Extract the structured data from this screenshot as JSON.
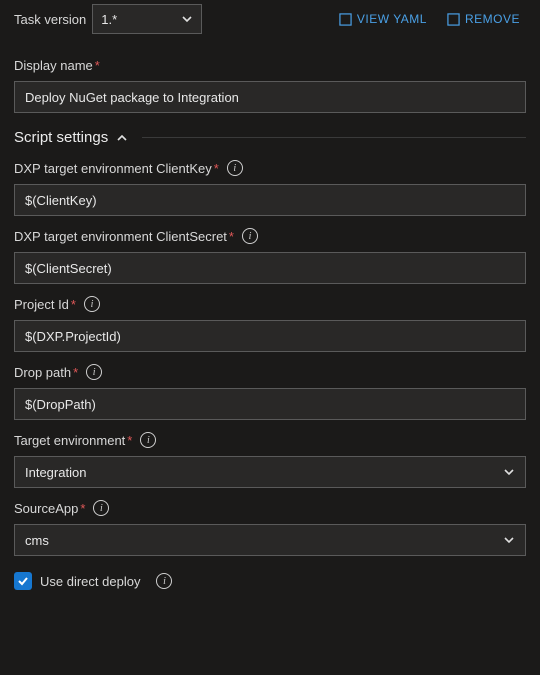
{
  "header": {
    "task_version_label": "Task version",
    "task_version_value": "1.*",
    "action_view": "VIEW YAML",
    "action_remove": "REMOVE"
  },
  "display_name": {
    "label": "Display name",
    "value": "Deploy NuGet package to Integration"
  },
  "section": {
    "title": "Script settings"
  },
  "fields": {
    "client_key": {
      "label": "DXP target environment ClientKey",
      "value": "$(ClientKey)"
    },
    "client_secret": {
      "label": "DXP target environment ClientSecret",
      "value": "$(ClientSecret)"
    },
    "project_id": {
      "label": "Project Id",
      "value": "$(DXP.ProjectId)"
    },
    "drop_path": {
      "label": "Drop path",
      "value": "$(DropPath)"
    },
    "target_env": {
      "label": "Target environment",
      "value": "Integration"
    },
    "source_app": {
      "label": "SourceApp",
      "value": "cms"
    },
    "direct_deploy": {
      "label": "Use direct deploy",
      "checked": true
    }
  }
}
